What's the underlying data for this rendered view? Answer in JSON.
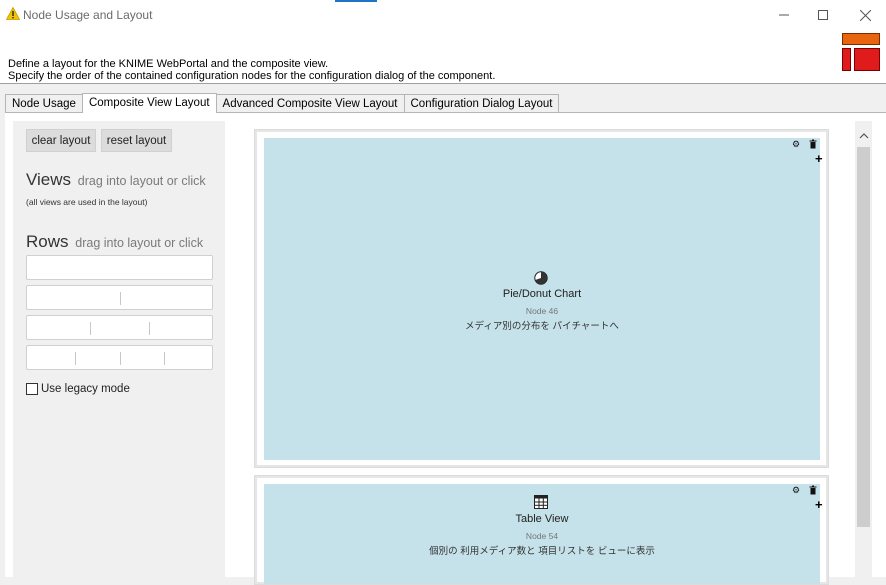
{
  "window": {
    "title": "Node Usage and Layout",
    "colors": {
      "accent": "#1f74c8",
      "cell_bg": "#c5e1ea",
      "logo_orange": "#e8640e",
      "logo_red": "#e01b1b"
    }
  },
  "header": {
    "description_line1": "Define a layout for the KNIME WebPortal and the composite view.",
    "description_line2": "Specify the order of the contained configuration nodes for the configuration dialog of the component."
  },
  "tabs": [
    {
      "label": "Node Usage",
      "active": false
    },
    {
      "label": "Composite View Layout",
      "active": true
    },
    {
      "label": "Advanced Composite View Layout",
      "active": false
    },
    {
      "label": "Configuration Dialog Layout",
      "active": false
    }
  ],
  "left_panel": {
    "clear_label": "clear layout",
    "reset_label": "reset layout",
    "views_title": "Views",
    "views_hint": "drag into layout or click",
    "views_note": "(all views are used in the layout)",
    "rows_title": "Rows",
    "rows_hint": "drag into layout or click",
    "legacy_label": "Use legacy mode",
    "legacy_checked": false
  },
  "layout": {
    "cells": [
      {
        "icon": "pie-chart-icon",
        "title": "Pie/Donut Chart",
        "node_id": "Node 46",
        "description": "メディア別の分布を パイチャートへ"
      },
      {
        "icon": "table-icon",
        "title": "Table View",
        "node_id": "Node 54",
        "description": "個別の 利用メディア数と 項目リストを ビューに表示"
      }
    ]
  }
}
